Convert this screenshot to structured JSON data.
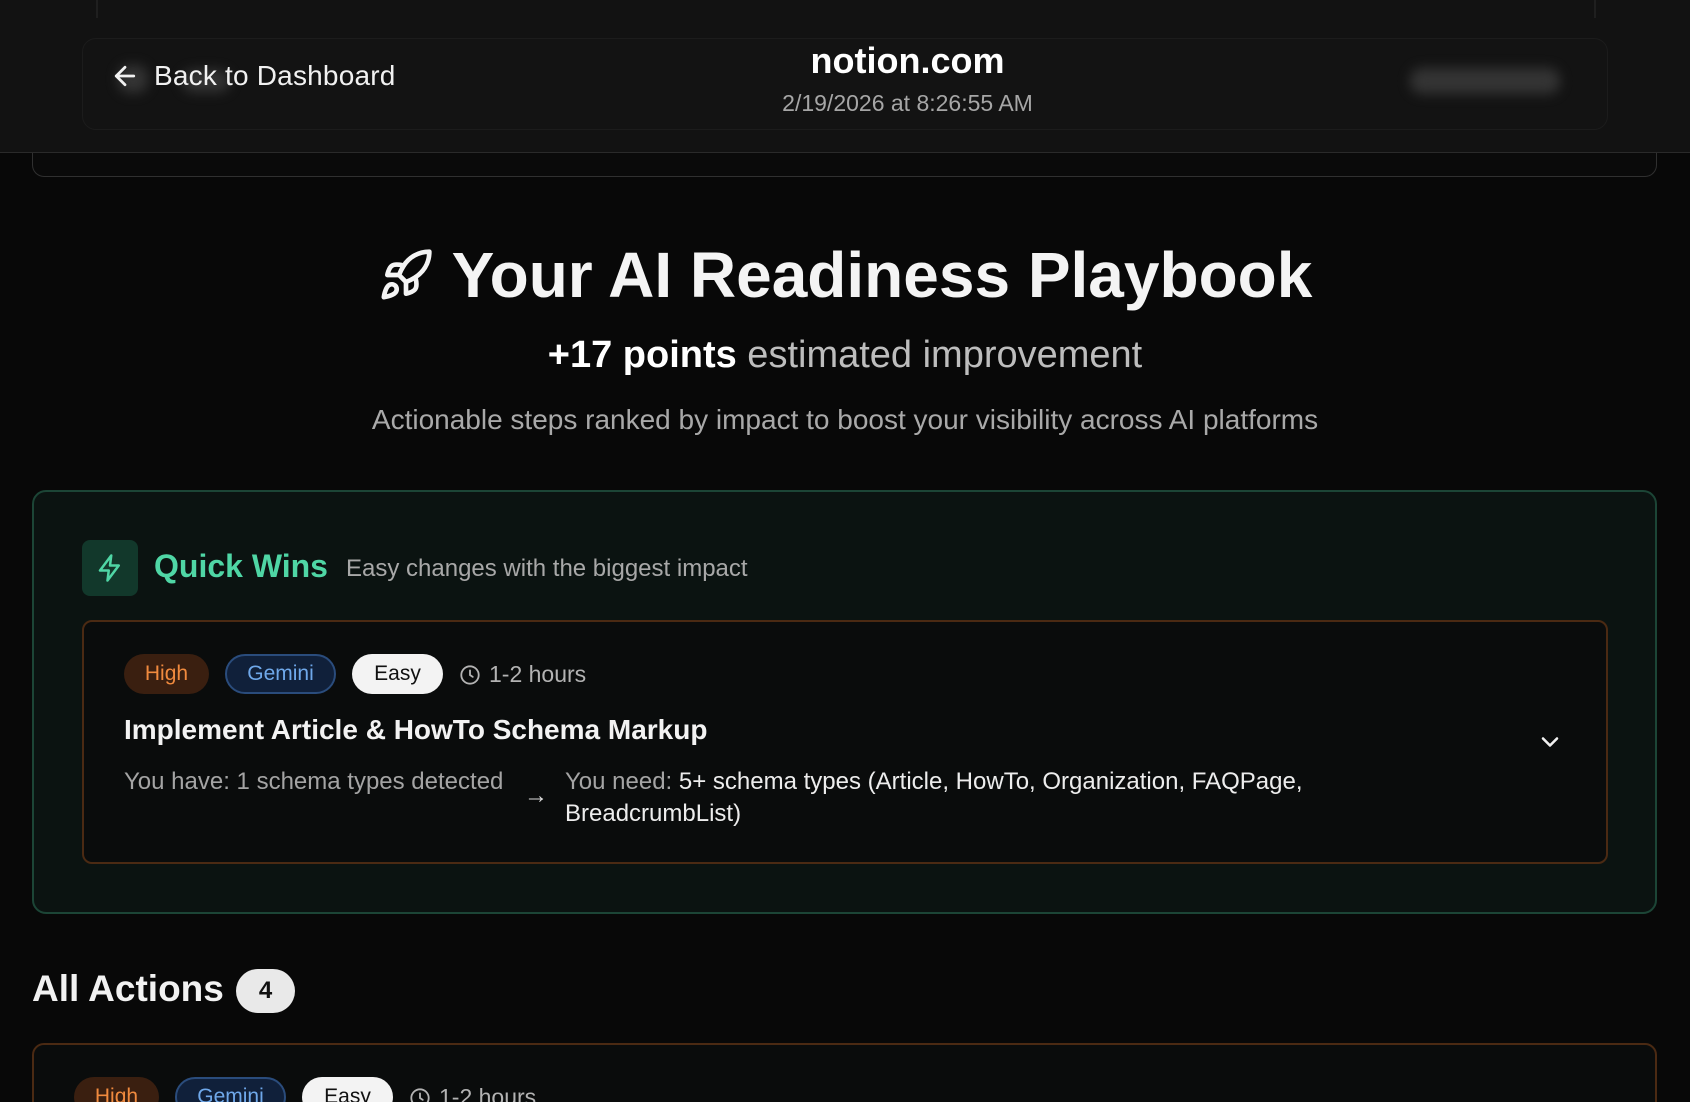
{
  "header": {
    "back_label": "Back to Dashboard",
    "domain": "notion.com",
    "date": "2/19/2026 at 8:26:55 AM"
  },
  "hero": {
    "title": "Your AI Readiness Playbook",
    "points_strong": "+17 points",
    "points_rest": " estimated improvement",
    "subtitle": "Actionable steps ranked by impact to boost your visibility across AI platforms"
  },
  "quick_wins": {
    "title": "Quick Wins",
    "description": "Easy changes with the biggest impact",
    "action": {
      "priority": "High",
      "platform": "Gemini",
      "difficulty": "Easy",
      "time": "1-2 hours",
      "title": "Implement Article & HowTo Schema Markup",
      "have_label": "You have:",
      "have_value": " 1 schema types detected",
      "need_label": "You need:",
      "need_value": " 5+ schema types (Article, HowTo, Organization, FAQPage, BreadcrumbList)"
    }
  },
  "all_actions": {
    "title": "All Actions",
    "count": "4",
    "first": {
      "priority": "High",
      "platform": "Gemini",
      "difficulty": "Easy",
      "time": "1-2 hours"
    }
  },
  "colors": {
    "quick_wins_accent": "#4fd6a5",
    "high_badge": "#f08a3e",
    "gemini_badge": "#6fa8ea"
  }
}
